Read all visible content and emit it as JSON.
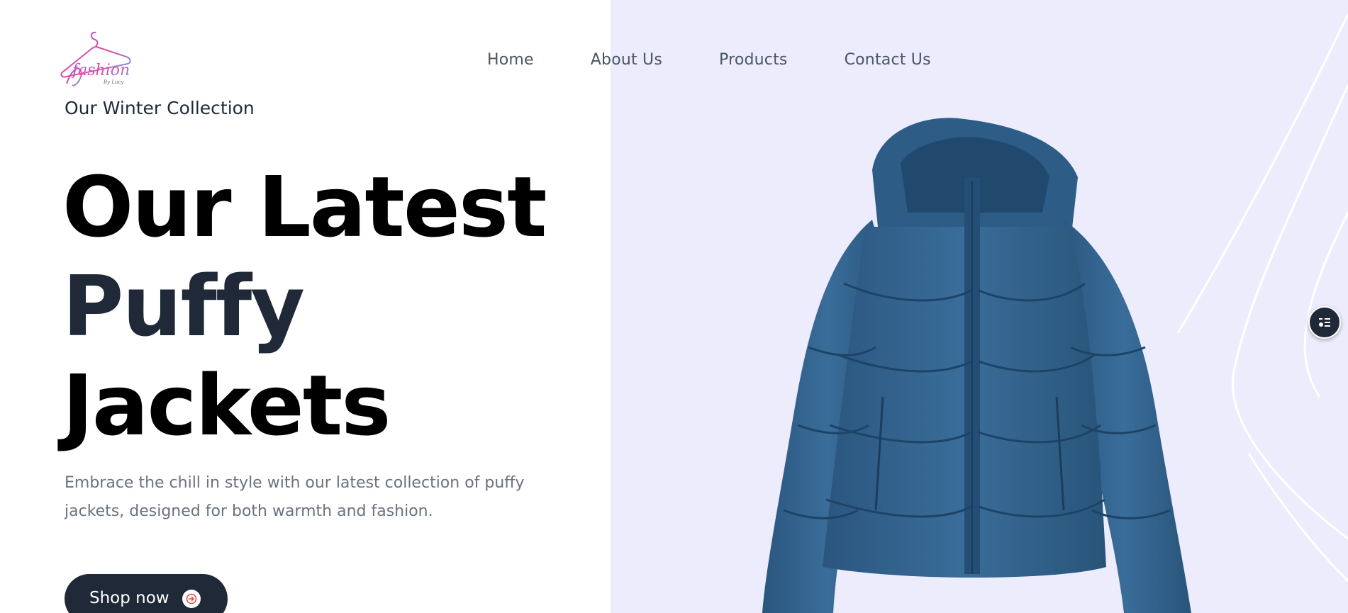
{
  "nav": {
    "items": [
      {
        "label": "Home"
      },
      {
        "label": "About Us"
      },
      {
        "label": "Products"
      },
      {
        "label": "Contact Us"
      }
    ]
  },
  "logo": {
    "text": "fashion",
    "subtext": "By Lucy"
  },
  "hero": {
    "eyebrow": "Our Winter Collection",
    "headline_line1": "Our Latest",
    "headline_line2": "Puffy",
    "headline_line3": "Jackets",
    "description": "Embrace the chill in style with our latest collection of puffy jackets, designed for both warmth and fashion.",
    "cta_label": "Shop now"
  },
  "colors": {
    "panel": "#ececfd",
    "primary": "#1f2937",
    "arrow_accent": "#ef4444",
    "jacket": "#2f5f8a"
  },
  "icons": {
    "cta_icon": "arrow-right-circle-icon",
    "float_icon": "menu-list-icon"
  }
}
